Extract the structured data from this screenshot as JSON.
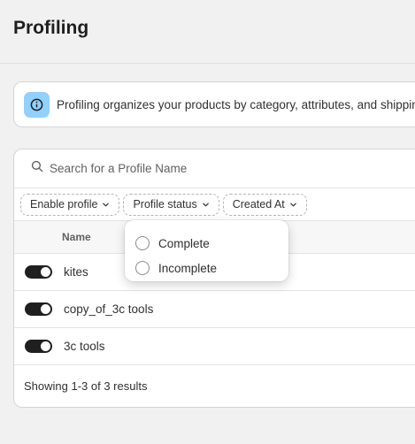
{
  "page": {
    "title": "Profiling"
  },
  "banner": {
    "icon": "info-icon",
    "text": "Profiling organizes your products by category, attributes, and shipping rules."
  },
  "search": {
    "placeholder": "Search for a Profile Name",
    "value": ""
  },
  "filters": [
    {
      "label": "Enable profile"
    },
    {
      "label": "Profile status"
    },
    {
      "label": "Created At"
    }
  ],
  "table": {
    "columns": [
      "Name"
    ],
    "rows": [
      {
        "name": "kites",
        "enabled": true
      },
      {
        "name": "copy_of_3c tools",
        "enabled": true
      },
      {
        "name": "3c tools",
        "enabled": true
      }
    ]
  },
  "footer": {
    "text": "Showing 1-3 of 3 results"
  },
  "status_popover": {
    "options": [
      "Complete",
      "Incomplete"
    ]
  },
  "colors": {
    "info_accent": "#91d0ff",
    "toggle_on": "#1f1f1f"
  }
}
